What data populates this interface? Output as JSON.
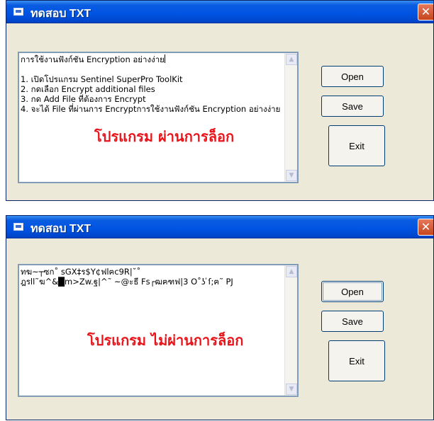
{
  "colors": {
    "titlebar": "#0054e3",
    "overlay": "#e8141a",
    "window_bg": "#ece9d8"
  },
  "window1": {
    "title": "ทดสอบ TXT",
    "close_glyph": "✕",
    "lines": [
      "การใช้งานฟังก์ชัน Encryption อย่างง่าย",
      "",
      "1. เปิดโปรแกรม Sentinel SuperPro ToolKit",
      "2. กดเลือก Encrypt additional files",
      "3. กด Add File ที่ต้องการ Encrypt",
      "4. จะได้ File ที่ผ่านการ Encryptการใช้งานฟังก์ชัน Encryption อย่างง่าย"
    ],
    "overlay": "โปรแกรม ผ่านการล็อก",
    "buttons": {
      "open": "Open",
      "save": "Save",
      "exit": "Exit"
    }
  },
  "window2": {
    "title": "ทดสอบ TXT",
    "close_glyph": "✕",
    "lines": [
      "ทฆ~┬ซก˚ sGX‡ร$Y¢ฟlฅc9R|˘˚",
      "ฎรll˜ฆ^&█m>Zw.ฐ|^˜ ~@ะธี Fs┌ฒฅฑฟ|3 O˚ʖ ̍ſ;ฅ˜ PJ"
    ],
    "overlay": "โปรแกรม ไม่ผ่านการล็อก",
    "buttons": {
      "open": "Open",
      "save": "Save",
      "exit": "Exit"
    }
  }
}
